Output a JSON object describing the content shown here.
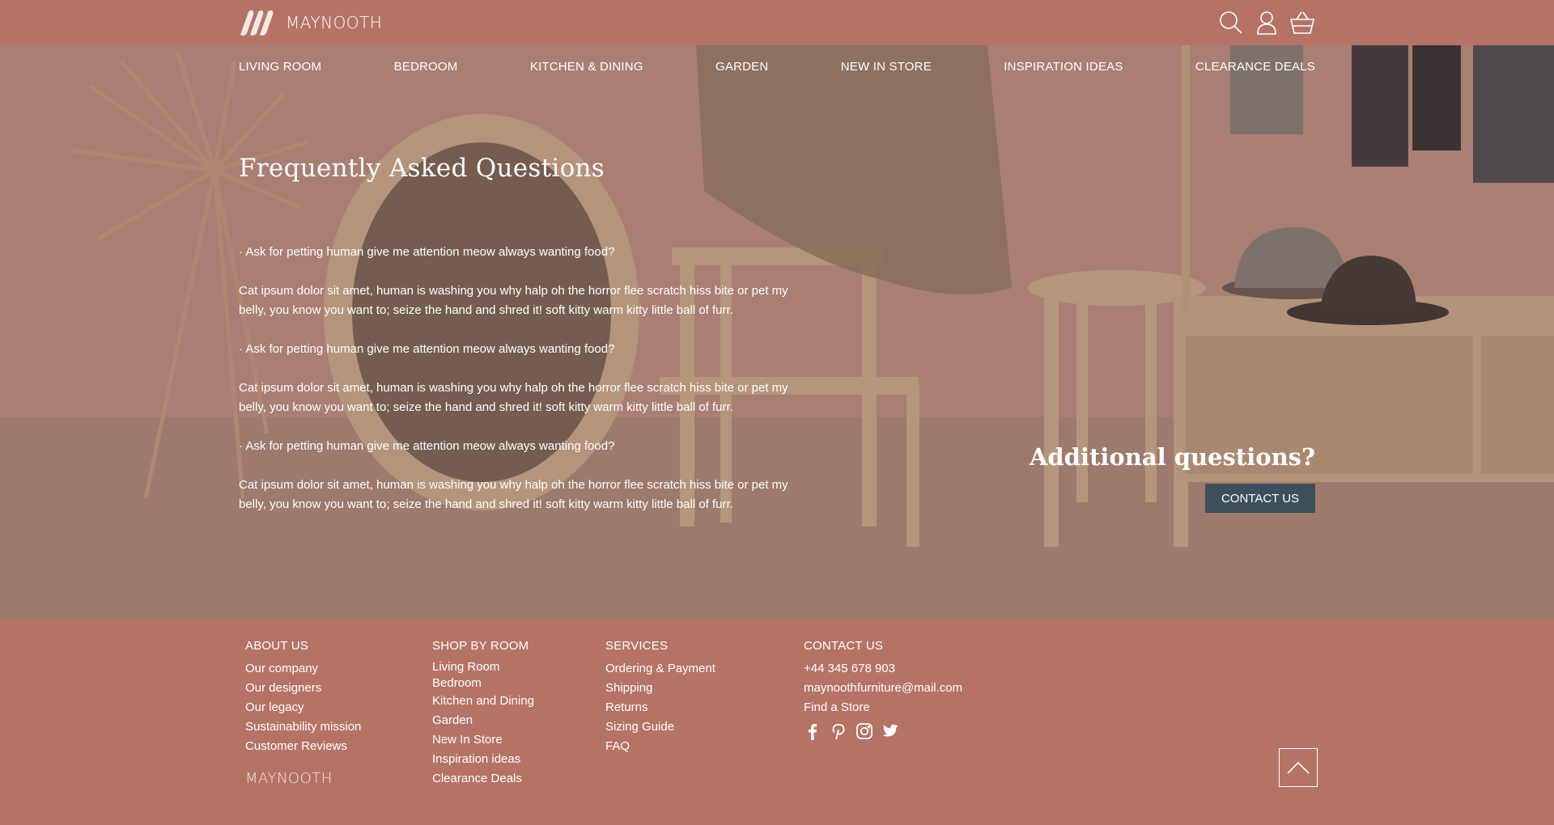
{
  "header": {
    "brand": "MAYNOOTH",
    "icons": [
      "search-icon",
      "user-icon",
      "basket-icon"
    ]
  },
  "nav": {
    "items": [
      {
        "label": "LIVING ROOM"
      },
      {
        "label": "BEDROOM"
      },
      {
        "label": "KITCHEN & DINING"
      },
      {
        "label": "GARDEN"
      },
      {
        "label": "NEW IN STORE"
      },
      {
        "label": "INSPIRATION IDEAS"
      },
      {
        "label": "CLEARANCE DEALS"
      }
    ]
  },
  "main": {
    "title": "Frequently Asked Questions",
    "faq": [
      {
        "q": "· Ask for petting human give me attention meow always wanting food?",
        "a": "Cat ipsum dolor sit amet, human is washing you why halp oh the horror flee scratch hiss bite or pet my belly, you know you want to; seize the hand and shred it! soft kitty warm kitty little ball of furr."
      },
      {
        "q": "· Ask for petting human give me attention meow always wanting food?",
        "a": "Cat ipsum dolor sit amet, human is washing you why halp oh the horror flee scratch hiss bite or pet my belly, you know you want to; seize the hand and shred it! soft kitty warm kitty little ball of furr."
      },
      {
        "q": "· Ask for petting human give me attention meow always wanting food?",
        "a": "Cat ipsum dolor sit amet, human is washing you why halp oh the horror flee scratch hiss bite or pet my belly, you know you want to; seize the hand and shred it! soft kitty warm kitty little ball of furr."
      }
    ],
    "additional": "Additional questions?",
    "contact_button": "CONTACT US"
  },
  "footer": {
    "about": {
      "heading": "ABOUT US",
      "links": [
        "Our company",
        "Our designers",
        "Our legacy",
        "Sustainability mission",
        "Customer Reviews"
      ]
    },
    "shop": {
      "heading": "SHOP BY ROOM",
      "links": [
        "Living Room",
        "Bedroom",
        "Kitchen and Dining",
        "Garden",
        "New In Store",
        "Inspiration ideas",
        "Clearance Deals"
      ]
    },
    "services": {
      "heading": "SERVICES",
      "links": [
        "Ordering & Payment",
        "Shipping",
        "Returns",
        "Sizing Guide",
        "FAQ"
      ]
    },
    "contact": {
      "heading": "CONTACT US",
      "phone": "+44 345 678 903",
      "email": "maynoothfurniture@mail.com",
      "store": "Find a Store",
      "social": [
        "facebook-icon",
        "pinterest-icon",
        "instagram-icon",
        "twitter-icon"
      ]
    },
    "brand": "MAYNOOTH"
  },
  "colors": {
    "brand_bg": "#b57366",
    "button_bg": "#3d4f5b",
    "text": "#ffffff"
  }
}
